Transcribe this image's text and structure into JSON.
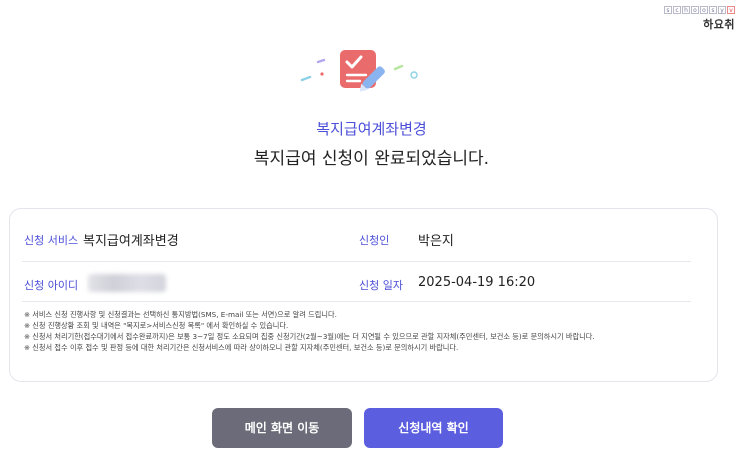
{
  "logo": {
    "strip": [
      "s",
      "c",
      "h",
      "o",
      "o",
      "s",
      "y",
      "v"
    ],
    "text": "하요취"
  },
  "header": {
    "service_name": "복지급여계좌변경",
    "message": "복지급여 신청이 완료되었습니다."
  },
  "info": {
    "service_label": "신청 서비스",
    "service_value": "복지급여계좌변경",
    "applicant_label": "신청인",
    "applicant_value": "박은지",
    "id_label": "신청 아이디",
    "date_label": "신청 일자",
    "date_value": "2025-04-19 16:20"
  },
  "notes": [
    "※ 서비스 신청 진행사항 및 신청결과는 선택하신 통지방법(SMS, E-mail 또는 서면)으로 알려 드립니다.",
    "※ 신청 진행상황 조회 및 내역은 \"복지로>서비스신청 목록\" 에서 확인하실 수 있습니다.",
    "※ 신청서 처리기한(접수대기에서 접수완료까지)은 보통 3~7일 정도 소요되며 집중 신청기간(2월~3월)에는 더 지연될 수 있으므로 관할 지자체(주민센터, 보건소 등)로 문의하시기 바랍니다.",
    "※ 신청서 접수 이후 접수 및 판정 등에 대한 처리기간은 신청서비스에 따라 상이하오니 관할 지자체(주민센터, 보건소 등)로 문의하시기 바랍니다."
  ],
  "buttons": {
    "main": "메인 화면 이동",
    "check": "신청내역 확인"
  },
  "colors": {
    "accent": "#4c4fd8",
    "button_dark": "#6b6b79",
    "button_primary": "#5c5ee0",
    "icon_red": "#ea6b6b"
  }
}
